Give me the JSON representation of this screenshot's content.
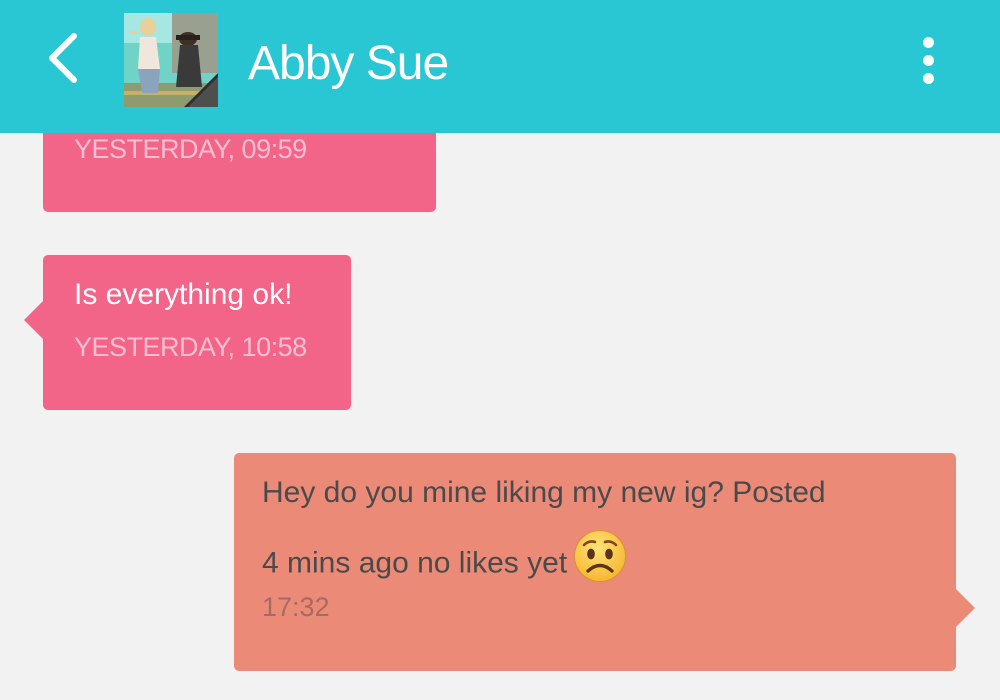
{
  "header": {
    "contact_name": "Abby Sue",
    "back_icon": "chevron-left-icon",
    "menu_icon": "more-vert-icon",
    "background_color": "#29c6d4"
  },
  "messages": [
    {
      "direction": "incoming",
      "text": "",
      "time": "YESTERDAY, 09:59"
    },
    {
      "direction": "incoming",
      "text": "Is everything ok!",
      "time": "YESTERDAY, 10:58"
    },
    {
      "direction": "outgoing",
      "text_line1": "Hey do you mine liking my new ig? Posted",
      "text_line2": "4 mins ago no likes yet",
      "emoji": "worried-face-emoji",
      "time": "17:32"
    }
  ],
  "colors": {
    "incoming_bubble": "#f36489",
    "outgoing_bubble": "#ec8a78",
    "background": "#f2f2f2"
  }
}
